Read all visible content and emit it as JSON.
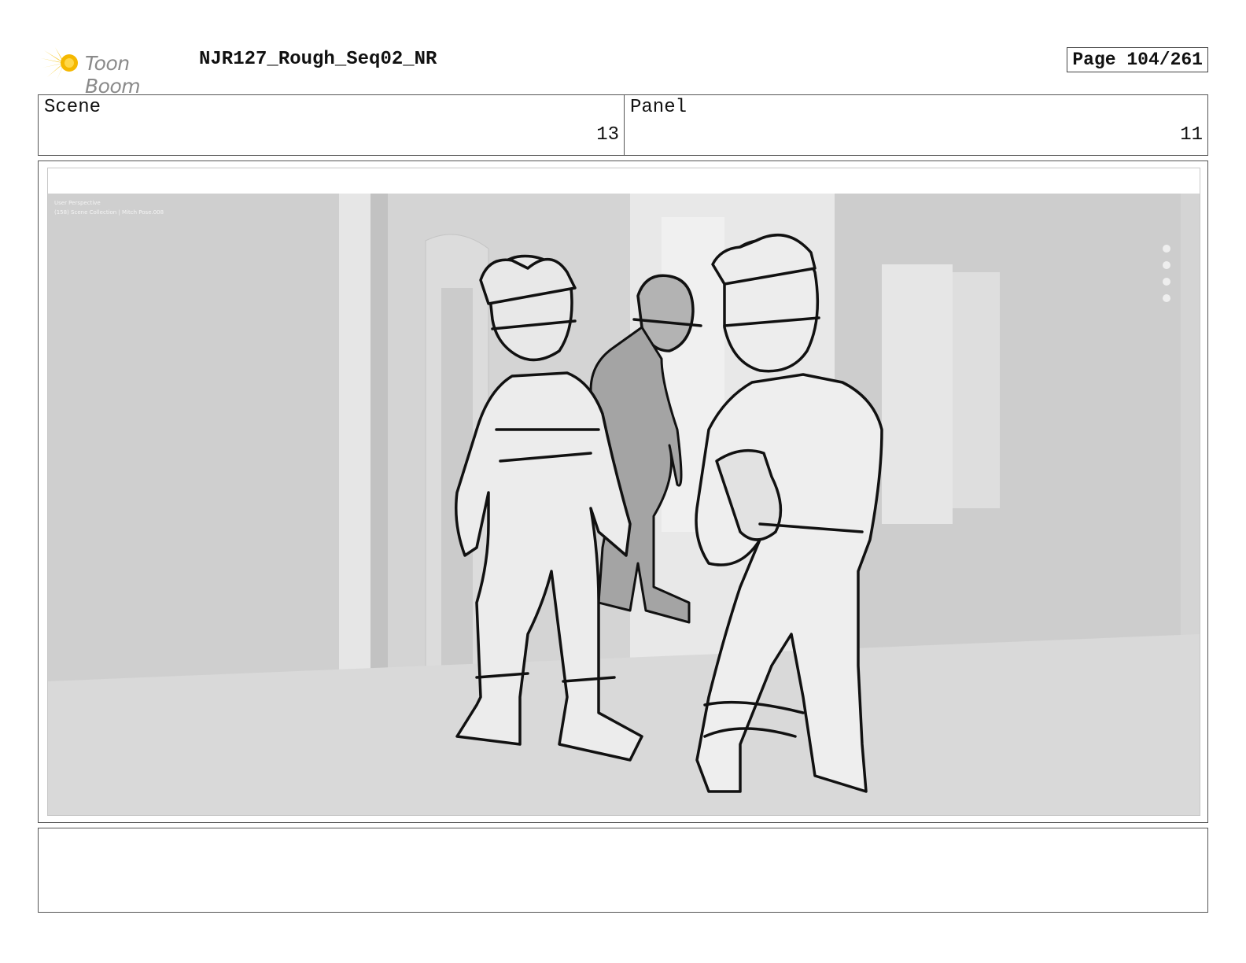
{
  "header": {
    "logo_text": "Toon Boom",
    "document_title": "NJR127_Rough_Seq02_NR",
    "page_label": "Page 104/261"
  },
  "info": {
    "scene_label": "Scene",
    "scene_value": "13",
    "panel_label": "Panel",
    "panel_value": "11"
  },
  "viewport": {
    "perspective_text": "User Perspective",
    "collection_text": "(158) Scene Collection | Mitch Pose.008"
  },
  "notes": {
    "text": ""
  },
  "colors": {
    "logo_accent": "#f5c518",
    "frame_border": "#555555",
    "background_art": "#d6d6d6"
  }
}
